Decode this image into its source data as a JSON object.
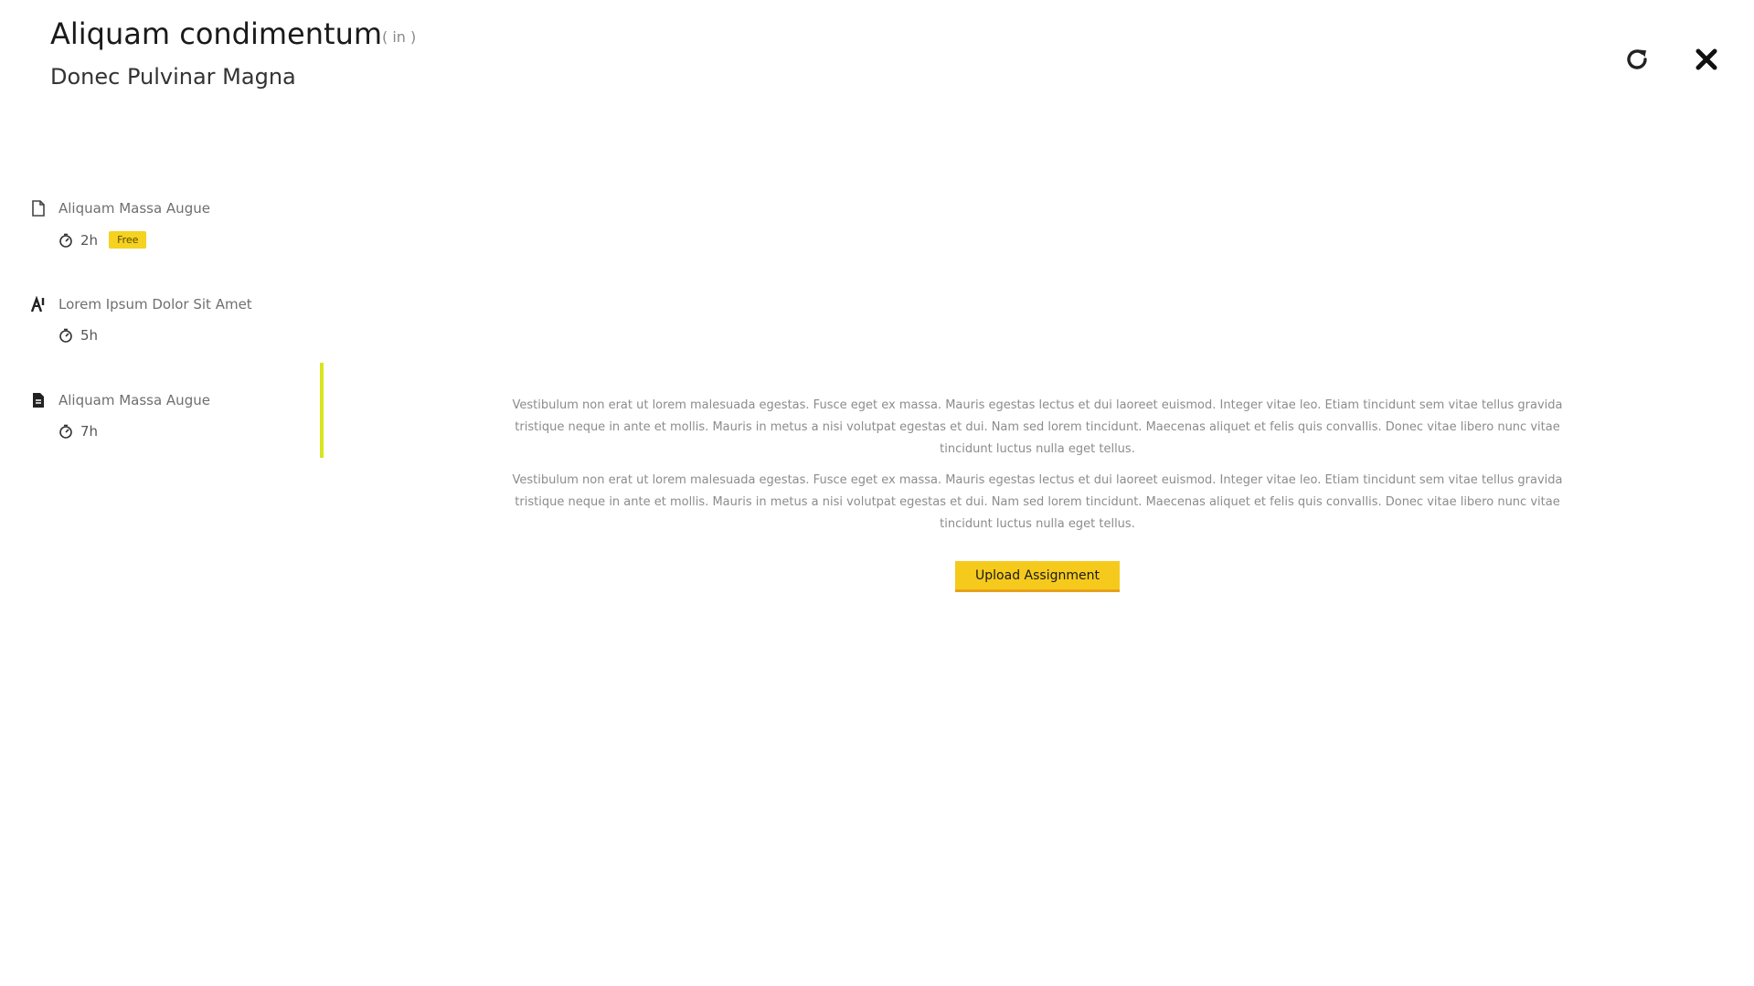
{
  "header": {
    "title": "Aliquam condimentum",
    "tag": "( in )",
    "subtitle": "Donec Pulvinar Magna",
    "refresh_icon": "refresh-icon",
    "close_icon": "close-icon"
  },
  "sidebar": {
    "lessons": [
      {
        "icon": "document-icon",
        "title": "Aliquam Massa Augue",
        "duration": "2h",
        "badge": "Free"
      },
      {
        "icon": "quiz-icon",
        "title": "Lorem Ipsum Dolor Sit Amet",
        "duration": "5h"
      },
      {
        "icon": "assignment-icon",
        "title": "Aliquam Massa Augue",
        "duration": "7h"
      }
    ],
    "active_index": 2,
    "accent_color": "#d8e51d"
  },
  "main": {
    "paragraphs": [
      "Vestibulum non erat ut lorem malesuada egestas. Fusce eget ex massa. Mauris egestas lectus et dui laoreet euismod. Integer vitae leo. Etiam tincidunt sem vitae tellus gravida tristique neque in ante et mollis. Mauris in metus a nisi volutpat egestas et dui. Nam sed lorem tincidunt. Maecenas aliquet et felis quis convallis. Donec vitae libero nunc vitae tincidunt luctus nulla eget tellus.",
      "Vestibulum non erat ut lorem malesuada egestas. Fusce eget ex massa. Mauris egestas lectus et dui laoreet euismod. Integer vitae leo. Etiam tincidunt sem vitae tellus gravida tristique neque in ante et mollis. Mauris in metus a nisi volutpat egestas et dui. Nam sed lorem tincidunt. Maecenas aliquet et felis quis convallis. Donec vitae libero nunc vitae tincidunt luctus nulla eget tellus."
    ],
    "upload_label": "Upload Assignment",
    "button_color": "#f6ca1c"
  }
}
